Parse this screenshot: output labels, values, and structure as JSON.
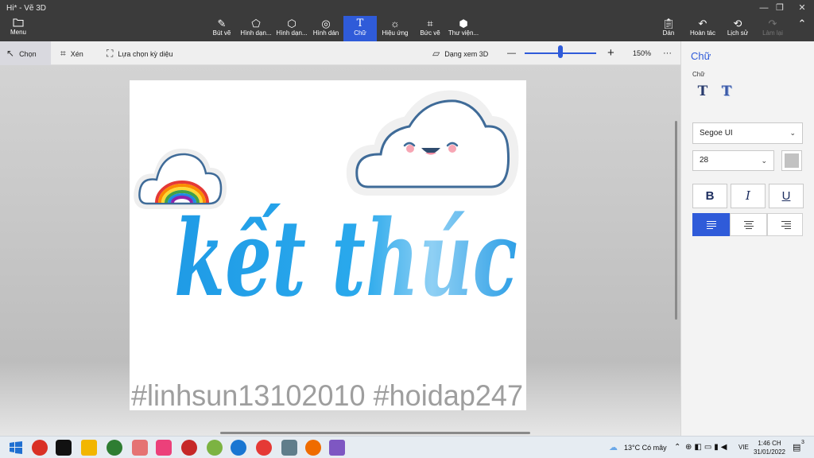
{
  "window": {
    "title": "Hi* - Vẽ 3D",
    "controls": [
      "—",
      "❐",
      "✕"
    ]
  },
  "ribbon": {
    "menu": "Menu",
    "tools": [
      {
        "label": "Bút vẽ",
        "icon": "brush-icon"
      },
      {
        "label": "Hình dạn...",
        "icon": "2d-shapes-icon"
      },
      {
        "label": "Hình dạn...",
        "icon": "3d-shapes-icon"
      },
      {
        "label": "Hình dán",
        "icon": "stickers-icon"
      },
      {
        "label": "Chữ",
        "icon": "text-icon"
      },
      {
        "label": "Hiệu ứng",
        "icon": "effects-icon"
      },
      {
        "label": "Bức vẽ",
        "icon": "canvas-icon"
      },
      {
        "label": "Thư viện...",
        "icon": "3d-library-icon"
      }
    ],
    "right": [
      {
        "label": "Dán",
        "icon": "paste-icon"
      },
      {
        "label": "Hoàn tác",
        "icon": "undo-icon"
      },
      {
        "label": "Lịch sử",
        "icon": "history-icon"
      },
      {
        "label": "Làm lại",
        "icon": "redo-icon"
      }
    ]
  },
  "toolbar": {
    "select": "Chọn",
    "crop": "Xén",
    "magic_select": "Lựa chọn kỳ diệu",
    "view_3d": "Dạng xem 3D",
    "zoom_minus": "—",
    "zoom_plus": "+",
    "zoom": "150%",
    "more": "···",
    "zoom_level_fraction": 0.5
  },
  "canvas": {
    "headline": "kết thúc",
    "watermark": "#linhsun13102010 #hoidap247"
  },
  "panel": {
    "title": "Chữ",
    "subtitle": "Chữ",
    "font": "Segoe UI",
    "size": "28",
    "bold": "B",
    "italic": "I",
    "underline": "U",
    "text_color": "#c2c2c2"
  },
  "taskbar": {
    "weather": "13°C  Có mây",
    "lang": "VIE",
    "time": "1:46 CH",
    "date": "31/01/2022",
    "notif_count": "3"
  },
  "colors": {
    "accent": "#2f5bd9",
    "titlebar": "#3b3b3b",
    "headline_blue": "#29a3e8",
    "cloud_outline": "#3f6b98"
  }
}
